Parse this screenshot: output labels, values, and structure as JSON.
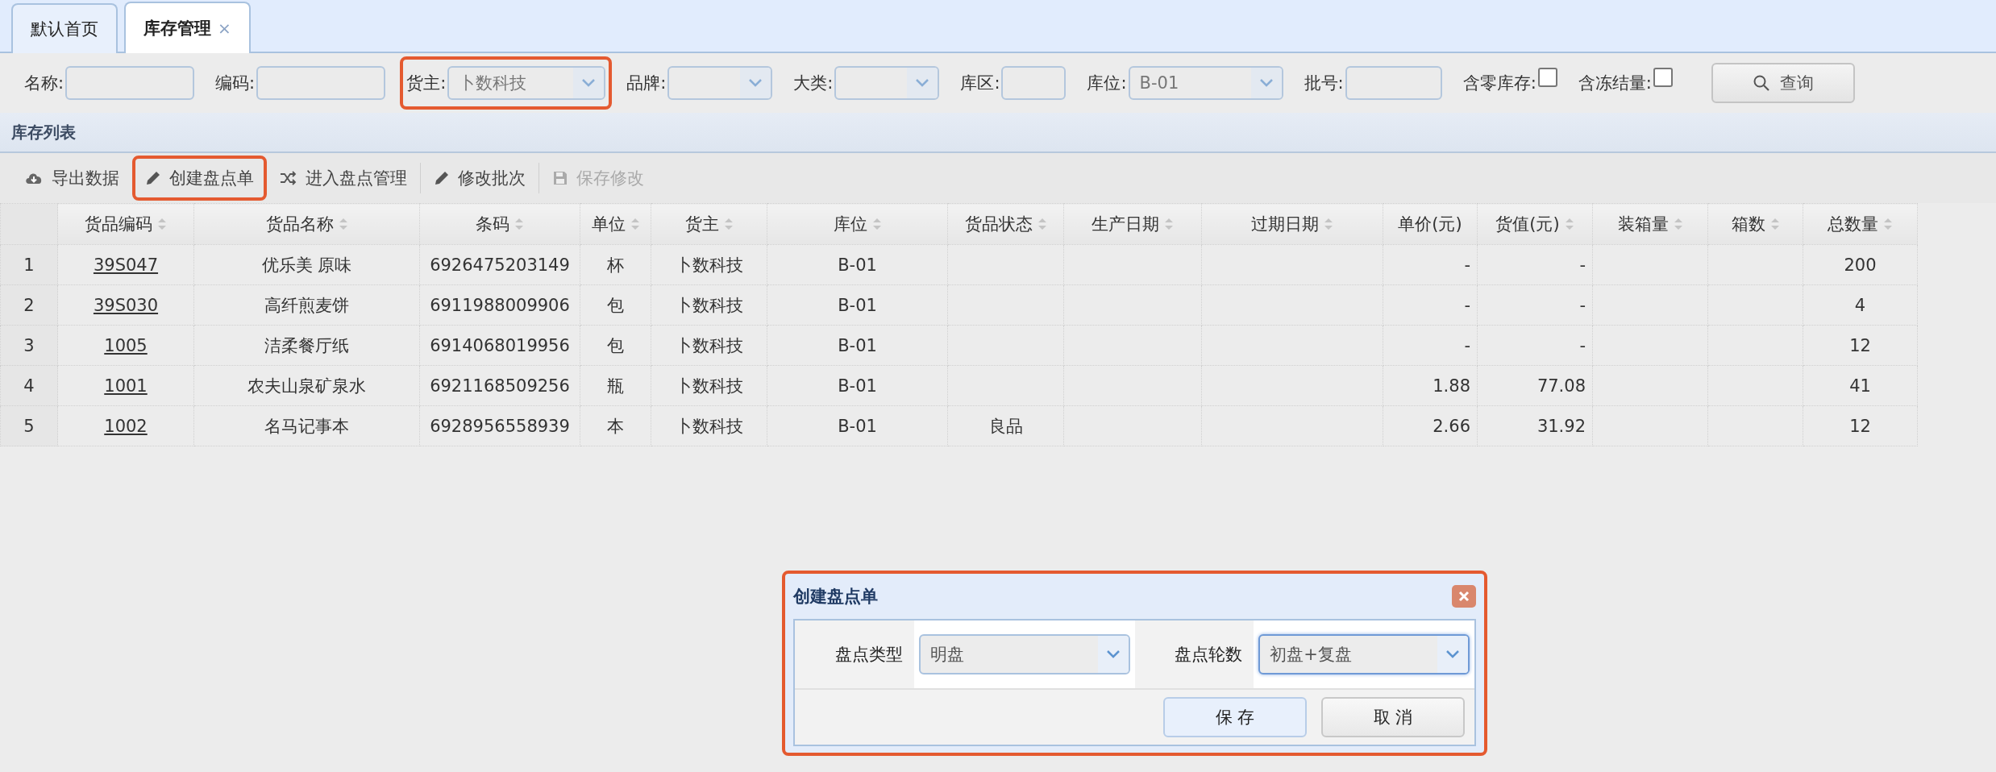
{
  "tabs": [
    {
      "label": "默认首页",
      "selected": false
    },
    {
      "label": "库存管理",
      "selected": true,
      "close": "×"
    }
  ],
  "filters": [
    {
      "label": "名称:",
      "kind": "text",
      "highlighted": false
    },
    {
      "label": "编码:",
      "kind": "text",
      "highlighted": false
    },
    {
      "label": "货主:",
      "kind": "select",
      "value": "卜数科技",
      "highlighted": true
    },
    {
      "label": "品牌:",
      "kind": "select",
      "highlighted": false
    },
    {
      "label": "大类:",
      "kind": "select",
      "highlighted": false
    },
    {
      "label": "库区:",
      "kind": "text",
      "highlighted": false
    },
    {
      "label": "库位:",
      "kind": "select",
      "value": "B-01",
      "highlighted": false
    },
    {
      "label": "批号:",
      "kind": "text",
      "highlighted": false
    },
    {
      "label": "含零库存:",
      "kind": "checkbox",
      "checked": false,
      "highlighted": false
    },
    {
      "label": "含冻结量:",
      "kind": "checkbox",
      "checked": false,
      "highlighted": false
    }
  ],
  "search_button": "查询",
  "section_title": "库存列表",
  "toolbar": [
    {
      "label": "导出数据",
      "disabled": false,
      "highlighted": false
    },
    {
      "label": "创建盘点单",
      "disabled": false,
      "highlighted": true
    },
    {
      "label": "进入盘点管理",
      "disabled": false,
      "highlighted": false
    },
    {
      "label": "修改批次",
      "disabled": false,
      "highlighted": false
    },
    {
      "label": "保存修改",
      "disabled": true,
      "highlighted": false
    }
  ],
  "table": {
    "columns": [
      {
        "label": "货品编码",
        "sortable": true
      },
      {
        "label": "货品名称",
        "sortable": true
      },
      {
        "label": "条码",
        "sortable": true
      },
      {
        "label": "单位",
        "sortable": true
      },
      {
        "label": "货主",
        "sortable": true
      },
      {
        "label": "库位",
        "sortable": true
      },
      {
        "label": "货品状态",
        "sortable": true
      },
      {
        "label": "生产日期",
        "sortable": true
      },
      {
        "label": "过期日期",
        "sortable": true
      },
      {
        "label": "单价(元)",
        "sortable": false
      },
      {
        "label": "货值(元)",
        "sortable": true
      },
      {
        "label": "装箱量",
        "sortable": true
      },
      {
        "label": "箱数",
        "sortable": true
      },
      {
        "label": "总数量",
        "sortable": true
      }
    ],
    "rows": [
      {
        "index": "1",
        "cells": [
          "39S047",
          "优乐美 原味",
          "6926475203149",
          "杯",
          "卜数科技",
          "B-01",
          "",
          "",
          "",
          "-",
          "-",
          "",
          "",
          "200"
        ]
      },
      {
        "index": "2",
        "cells": [
          "39S030",
          "高纤煎麦饼",
          "6911988009906",
          "包",
          "卜数科技",
          "B-01",
          "",
          "",
          "",
          "-",
          "-",
          "",
          "",
          "4"
        ]
      },
      {
        "index": "3",
        "cells": [
          "1005",
          "洁柔餐厅纸",
          "6914068019956",
          "包",
          "卜数科技",
          "B-01",
          "",
          "",
          "",
          "-",
          "-",
          "",
          "",
          "12"
        ]
      },
      {
        "index": "4",
        "cells": [
          "1001",
          "农夫山泉矿泉水",
          "6921168509256",
          "瓶",
          "卜数科技",
          "B-01",
          "",
          "",
          "",
          "1.88",
          "77.08",
          "",
          "",
          "41"
        ]
      },
      {
        "index": "5",
        "cells": [
          "1002",
          "名马记事本",
          "6928956558939",
          "本",
          "卜数科技",
          "B-01",
          "良品",
          "",
          "",
          "2.66",
          "31.92",
          "",
          "",
          "12"
        ]
      }
    ]
  },
  "dialog": {
    "title": "创建盘点单",
    "highlighted": true,
    "fields": [
      {
        "label": "盘点类型",
        "value": "明盘",
        "focused": false
      },
      {
        "label": "盘点轮数",
        "value": "初盘+复盘",
        "focused": true
      }
    ],
    "buttons": [
      {
        "label": "保 存",
        "primary": true
      },
      {
        "label": "取 消",
        "primary": false
      }
    ]
  }
}
